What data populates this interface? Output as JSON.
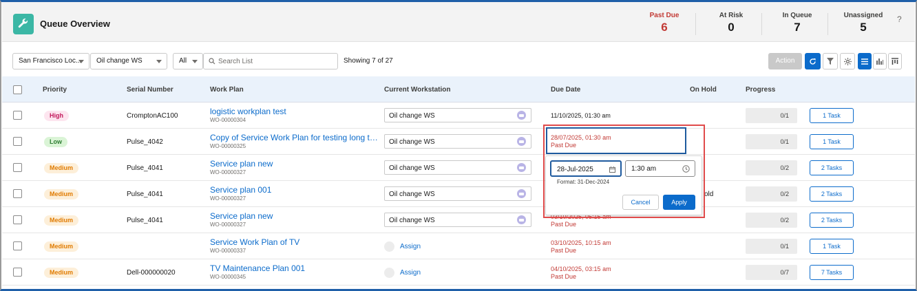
{
  "header": {
    "title": "Queue Overview",
    "stats": [
      {
        "label": "Past Due",
        "value": "6"
      },
      {
        "label": "At Risk",
        "value": "0"
      },
      {
        "label": "In Queue",
        "value": "7"
      },
      {
        "label": "Unassigned",
        "value": "5"
      }
    ],
    "help": "?"
  },
  "filters": {
    "location": "San Francisco Loc...",
    "workstation": "Oil change WS",
    "scope": "All",
    "search_placeholder": "Search List",
    "showing": "Showing 7 of 27",
    "action_label": "Action"
  },
  "columns": {
    "priority": "Priority",
    "serial": "Serial Number",
    "work_plan": "Work Plan",
    "workstation": "Current Workstation",
    "due_date": "Due Date",
    "on_hold": "On Hold",
    "progress": "Progress"
  },
  "rows": [
    {
      "priority": "High",
      "serial": "CromptonAC100",
      "plan": "logistic workplan test",
      "code": "WO-00000304",
      "ws": "Oil change WS",
      "due": "11/10/2025, 01:30 am",
      "due_status": "",
      "progress": "0/1",
      "tasks": "1 Task"
    },
    {
      "priority": "Low",
      "serial": "Pulse_4042",
      "plan": "Copy of Service Work Plan for testing long text i...",
      "code": "WO-00000325",
      "ws": "Oil change WS",
      "due": "28/07/2025, 01:30 am",
      "due_status": "Past Due",
      "progress": "0/1",
      "tasks": "1 Task"
    },
    {
      "priority": "Medium",
      "serial": "Pulse_4041",
      "plan": "Service plan new",
      "code": "WO-00000327",
      "ws": "Oil change WS",
      "due": "",
      "due_status": "",
      "progress": "0/2",
      "tasks": "2 Tasks"
    },
    {
      "priority": "Medium",
      "serial": "Pulse_4041",
      "plan": "Service plan 001",
      "code": "WO-00000327",
      "ws": "Oil change WS",
      "due": "",
      "due_status": "",
      "on_hold": "old",
      "progress": "0/2",
      "tasks": "2 Tasks"
    },
    {
      "priority": "Medium",
      "serial": "Pulse_4041",
      "plan": "Service plan new",
      "code": "WO-00000327",
      "ws": "Oil change WS",
      "due": "03/10/2025, 05:15 am",
      "due_status": "Past Due",
      "progress": "0/2",
      "tasks": "2 Tasks"
    },
    {
      "priority": "Medium",
      "serial": "",
      "plan": "Service Work Plan of TV",
      "code": "WO-00000337",
      "assign": "Assign",
      "due": "03/10/2025, 10:15 am",
      "due_status": "Past Due",
      "progress": "0/1",
      "tasks": "1 Task"
    },
    {
      "priority": "Medium",
      "serial": "Dell-000000020",
      "plan": "TV Maintenance Plan 001",
      "code": "WO-00000345",
      "assign": "Assign",
      "due": "04/10/2025, 03:15 am",
      "due_status": "Past Due",
      "progress": "0/7",
      "tasks": "7 Tasks"
    }
  ],
  "editor": {
    "date": "28-Jul-2025",
    "time": "1:30 am",
    "format_hint": "Format: 31-Dec-2024",
    "cancel": "Cancel",
    "apply": "Apply"
  },
  "colors": {
    "accent": "#0b6bcb",
    "danger": "#c23934",
    "brand": "#3bb7a5"
  }
}
